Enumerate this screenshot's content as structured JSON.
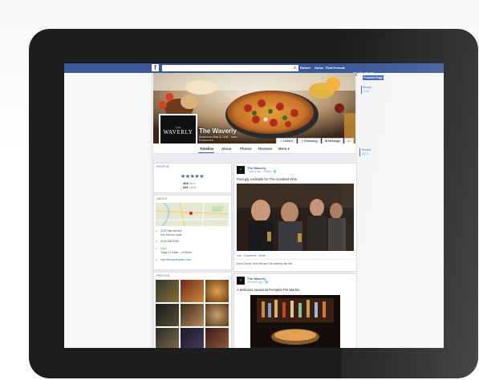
{
  "theme": {
    "fb_blue": "#3b5998",
    "link_blue": "#365899",
    "accent": "#4267b2",
    "open_green": "#42b72a"
  },
  "header": {
    "logo": "f",
    "search_icon": "search-icon",
    "nav": [
      "Robert",
      "Home",
      "Find Friends"
    ]
  },
  "cover": {
    "page_name": "The Waverly",
    "category": "American Bar & Grill · Irish",
    "subcategory": "Restaurant",
    "profile_logo_top": "THE",
    "profile_logo": "WAVERLY",
    "buttons": [
      "✓ Liked ▾",
      "✓ Following",
      "✉ Message",
      "•••"
    ]
  },
  "tabs": [
    "Timeline",
    "About",
    "Photos",
    "Reviews",
    "More ▾"
  ],
  "right_panel": {
    "promote_button": "Promote Page",
    "recent_label": "Recent",
    "recent_year": "2015",
    "second_label": "Recent",
    "second_year": "2014"
  },
  "people_card": {
    "title": "PEOPLE",
    "stars": "★★★★★",
    "likes_count": "403",
    "likes_label": "likes",
    "visits_count": "321",
    "visits_label": "visits"
  },
  "about_card": {
    "title": "ABOUT",
    "address": "2125 High-tail Ave",
    "city": "Des Moines, Iowa",
    "phone": "(515) 528-0250",
    "open_status": "Open",
    "hours": "Today 11:00am – 12:00am",
    "website": "http://thewaverlydsm.com/"
  },
  "photos_card": {
    "title": "PHOTOS"
  },
  "posts": [
    {
      "author": "The Waverly",
      "time": "7 hours ago · Edited · 🌐",
      "text": "Pool gig cocktails for The Crooked Wire",
      "actions": "Like · Comment · Share",
      "likes_line": "Dave Doctus, Nick Neil and The Waverly like this."
    },
    {
      "author": "The Waverly",
      "time": "20 hours ago · 🌐",
      "text": "A delicious seasonal Pumpkin Pie Martini."
    }
  ]
}
